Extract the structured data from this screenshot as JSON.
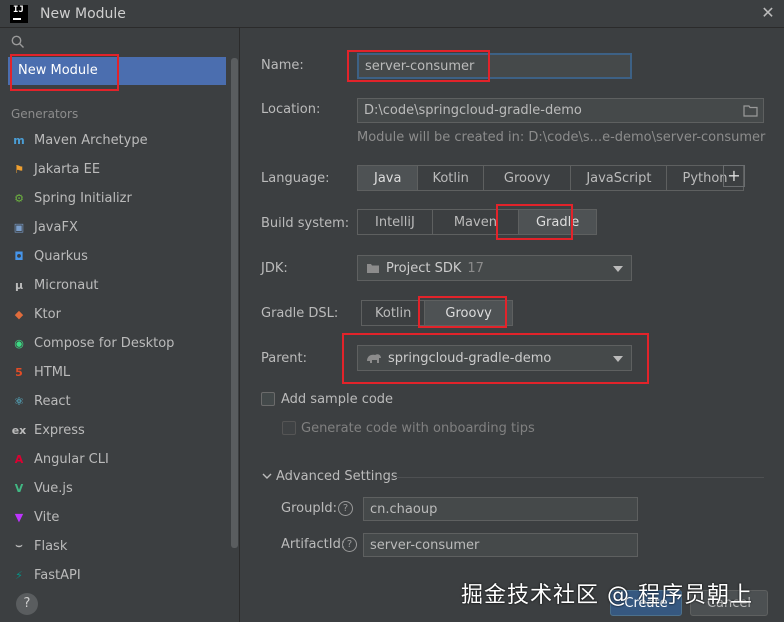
{
  "window": {
    "title": "New Module",
    "close": "✕"
  },
  "sidebar": {
    "selected": "New Module",
    "generators_label": "Generators",
    "items": [
      {
        "label": "Maven Archetype",
        "icon": "maven-icon",
        "glyph": "m",
        "color": "#4a9ed6"
      },
      {
        "label": "Jakarta EE",
        "icon": "jakarta-icon",
        "glyph": "⚑",
        "color": "#f0a030"
      },
      {
        "label": "Spring Initializr",
        "icon": "spring-icon",
        "glyph": "⚙",
        "color": "#6db33f"
      },
      {
        "label": "JavaFX",
        "icon": "javafx-icon",
        "glyph": "▣",
        "color": "#7a9ecb"
      },
      {
        "label": "Quarkus",
        "icon": "quarkus-icon",
        "glyph": "◘",
        "color": "#4695eb"
      },
      {
        "label": "Micronaut",
        "icon": "micronaut-icon",
        "glyph": "μ",
        "color": "#bbbbbb"
      },
      {
        "label": "Ktor",
        "icon": "ktor-icon",
        "glyph": "◆",
        "color": "#e06c3c"
      },
      {
        "label": "Compose for Desktop",
        "icon": "compose-icon",
        "glyph": "◉",
        "color": "#3ddc84"
      },
      {
        "label": "HTML",
        "icon": "html-icon",
        "glyph": "5",
        "color": "#e34c26"
      },
      {
        "label": "React",
        "icon": "react-icon",
        "glyph": "⚛",
        "color": "#61dafb"
      },
      {
        "label": "Express",
        "icon": "express-icon",
        "glyph": "ex",
        "color": "#bbbbbb"
      },
      {
        "label": "Angular CLI",
        "icon": "angular-icon",
        "glyph": "A",
        "color": "#dd0031"
      },
      {
        "label": "Vue.js",
        "icon": "vue-icon",
        "glyph": "V",
        "color": "#41b883"
      },
      {
        "label": "Vite",
        "icon": "vite-icon",
        "glyph": "▼",
        "color": "#bd34fe"
      },
      {
        "label": "Flask",
        "icon": "flask-icon",
        "glyph": "⌣",
        "color": "#bbbbbb"
      },
      {
        "label": "FastAPI",
        "icon": "fastapi-icon",
        "glyph": "⚡",
        "color": "#059487"
      }
    ],
    "help": "?"
  },
  "form": {
    "name_label": "Name:",
    "name_value": "server-consumer",
    "location_label": "Location:",
    "location_value": "D:\\code\\springcloud-gradle-demo",
    "location_hint": "Module will be created in: D:\\code\\s...e-demo\\server-consumer",
    "language_label": "Language:",
    "languages": [
      "Java",
      "Kotlin",
      "Groovy",
      "JavaScript",
      "Python"
    ],
    "language_selected": "Java",
    "build_label": "Build system:",
    "build_systems": [
      "IntelliJ",
      "Maven",
      "Gradle"
    ],
    "build_selected": "Gradle",
    "jdk_label": "JDK:",
    "jdk_value": "Project SDK",
    "jdk_version": "17",
    "dsl_label": "Gradle DSL:",
    "dsls": [
      "Kotlin",
      "Groovy"
    ],
    "dsl_selected": "Groovy",
    "parent_label": "Parent:",
    "parent_value": "springcloud-gradle-demo",
    "add_sample": "Add sample code",
    "onboarding": "Generate code with onboarding tips",
    "advanced_label": "Advanced Settings",
    "groupid_label": "GroupId:",
    "groupid_value": "cn.chaoup",
    "artifactid_label": "ArtifactId:",
    "artifactid_value": "server-consumer"
  },
  "buttons": {
    "create": "Create",
    "cancel": "Cancel"
  },
  "watermark": "掘金技术社区 @ 程序员朝上",
  "colors": {
    "accent": "#4b6eaf",
    "highlight": "#e2232a",
    "primary_button": "#365880"
  }
}
